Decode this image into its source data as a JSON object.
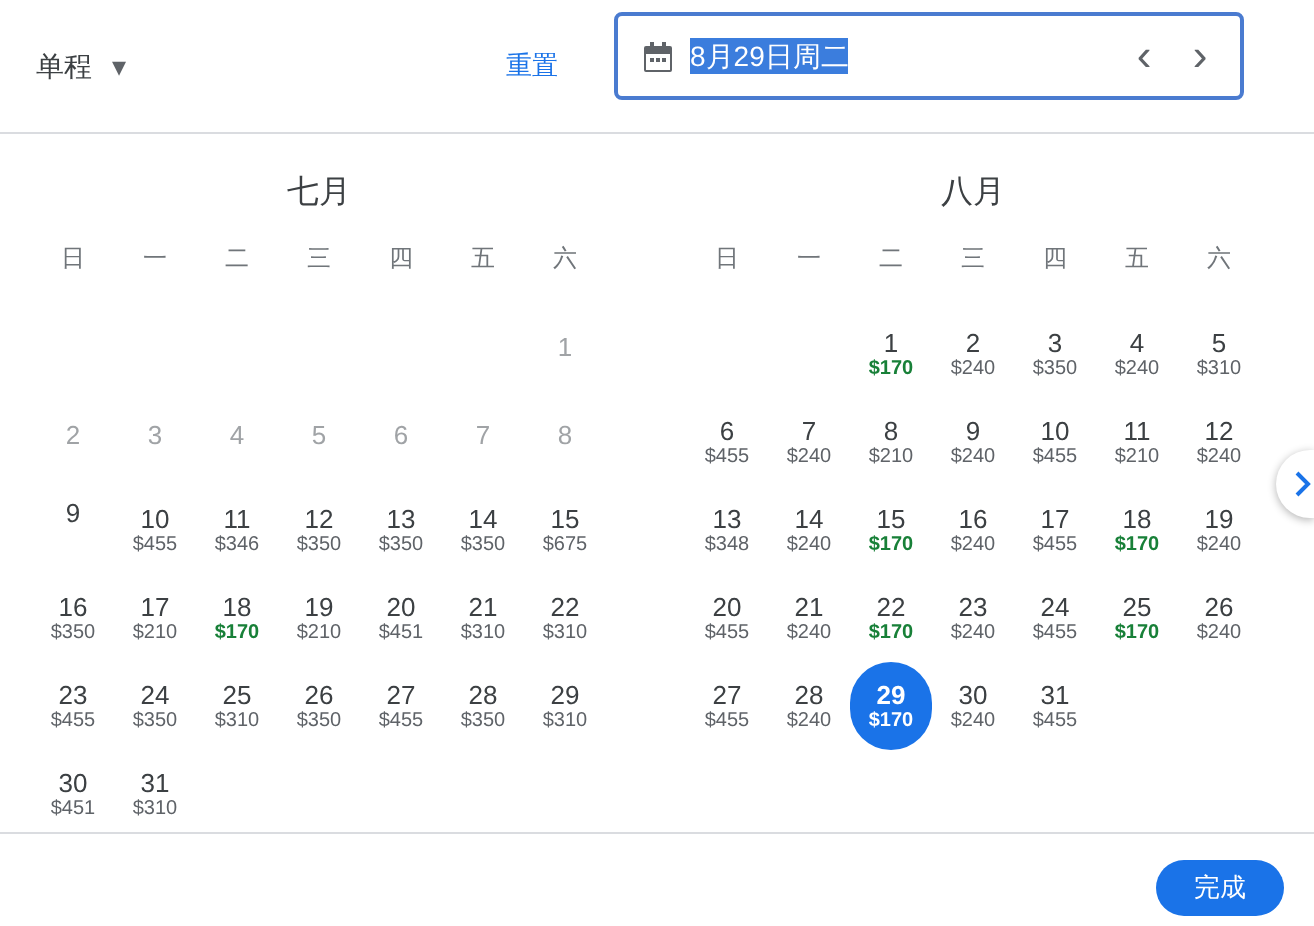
{
  "trip_type": {
    "label": "单程",
    "icon": "▾"
  },
  "reset_button": "重置",
  "date_field": {
    "value": "8月29日周二",
    "selected_text": true,
    "prev": "‹",
    "next": "›"
  },
  "months": [
    {
      "title": "七月",
      "weekdays": [
        "日",
        "一",
        "二",
        "三",
        "四",
        "五",
        "六"
      ],
      "weeks": [
        [
          {
            "kind": "blank"
          },
          {
            "kind": "blank"
          },
          {
            "kind": "blank"
          },
          {
            "kind": "blank"
          },
          {
            "kind": "blank"
          },
          {
            "kind": "blank"
          },
          {
            "kind": "past",
            "day": "1"
          }
        ],
        [
          {
            "kind": "past",
            "day": "2"
          },
          {
            "kind": "past",
            "day": "3"
          },
          {
            "kind": "past",
            "day": "4"
          },
          {
            "kind": "past",
            "day": "5"
          },
          {
            "kind": "past",
            "day": "6"
          },
          {
            "kind": "past",
            "day": "7"
          },
          {
            "kind": "past",
            "day": "8"
          }
        ],
        [
          {
            "kind": "day",
            "day": "9",
            "selected": false
          },
          {
            "kind": "day",
            "day": "10",
            "price": "$455",
            "selected": false,
            "cheap": false
          },
          {
            "kind": "day",
            "day": "11",
            "price": "$346",
            "selected": false,
            "cheap": false
          },
          {
            "kind": "day",
            "day": "12",
            "price": "$350",
            "selected": false,
            "cheap": false
          },
          {
            "kind": "day",
            "day": "13",
            "price": "$350",
            "selected": false,
            "cheap": false
          },
          {
            "kind": "day",
            "day": "14",
            "price": "$350",
            "selected": false,
            "cheap": false
          },
          {
            "kind": "day",
            "day": "15",
            "price": "$675",
            "selected": false,
            "cheap": false
          }
        ],
        [
          {
            "kind": "day",
            "day": "16",
            "price": "$350",
            "selected": false,
            "cheap": false
          },
          {
            "kind": "day",
            "day": "17",
            "price": "$210",
            "selected": false,
            "cheap": false
          },
          {
            "kind": "day",
            "day": "18",
            "price": "$170",
            "selected": false,
            "cheap": true
          },
          {
            "kind": "day",
            "day": "19",
            "price": "$210",
            "selected": false,
            "cheap": false
          },
          {
            "kind": "day",
            "day": "20",
            "price": "$451",
            "selected": false,
            "cheap": false
          },
          {
            "kind": "day",
            "day": "21",
            "price": "$310",
            "selected": false,
            "cheap": false
          },
          {
            "kind": "day",
            "day": "22",
            "price": "$310",
            "selected": false,
            "cheap": false
          }
        ],
        [
          {
            "kind": "day",
            "day": "23",
            "price": "$455",
            "selected": false,
            "cheap": false
          },
          {
            "kind": "day",
            "day": "24",
            "price": "$350",
            "selected": false,
            "cheap": false
          },
          {
            "kind": "day",
            "day": "25",
            "price": "$310",
            "selected": false,
            "cheap": false
          },
          {
            "kind": "day",
            "day": "26",
            "price": "$350",
            "selected": false,
            "cheap": false
          },
          {
            "kind": "day",
            "day": "27",
            "price": "$455",
            "selected": false,
            "cheap": false
          },
          {
            "kind": "day",
            "day": "28",
            "price": "$350",
            "selected": false,
            "cheap": false
          },
          {
            "kind": "day",
            "day": "29",
            "price": "$310",
            "selected": false,
            "cheap": false
          }
        ],
        [
          {
            "kind": "day",
            "day": "30",
            "price": "$451",
            "selected": false,
            "cheap": false
          },
          {
            "kind": "day",
            "day": "31",
            "price": "$310",
            "selected": false,
            "cheap": false
          }
        ]
      ]
    },
    {
      "title": "八月",
      "weekdays": [
        "日",
        "一",
        "二",
        "三",
        "四",
        "五",
        "六"
      ],
      "weeks": [
        [
          {
            "kind": "blank"
          },
          {
            "kind": "blank"
          },
          {
            "kind": "day",
            "day": "1",
            "price": "$170",
            "selected": false,
            "cheap": true
          },
          {
            "kind": "day",
            "day": "2",
            "price": "$240",
            "selected": false,
            "cheap": false
          },
          {
            "kind": "day",
            "day": "3",
            "price": "$350",
            "selected": false,
            "cheap": false
          },
          {
            "kind": "day",
            "day": "4",
            "price": "$240",
            "selected": false,
            "cheap": false
          },
          {
            "kind": "day",
            "day": "5",
            "price": "$310",
            "selected": false,
            "cheap": false
          }
        ],
        [
          {
            "kind": "day",
            "day": "6",
            "price": "$455",
            "selected": false,
            "cheap": false
          },
          {
            "kind": "day",
            "day": "7",
            "price": "$240",
            "selected": false,
            "cheap": false
          },
          {
            "kind": "day",
            "day": "8",
            "price": "$210",
            "selected": false,
            "cheap": false
          },
          {
            "kind": "day",
            "day": "9",
            "price": "$240",
            "selected": false,
            "cheap": false
          },
          {
            "kind": "day",
            "day": "10",
            "price": "$455",
            "selected": false,
            "cheap": false
          },
          {
            "kind": "day",
            "day": "11",
            "price": "$210",
            "selected": false,
            "cheap": false
          },
          {
            "kind": "day",
            "day": "12",
            "price": "$240",
            "selected": false,
            "cheap": false
          }
        ],
        [
          {
            "kind": "day",
            "day": "13",
            "price": "$348",
            "selected": false,
            "cheap": false
          },
          {
            "kind": "day",
            "day": "14",
            "price": "$240",
            "selected": false,
            "cheap": false
          },
          {
            "kind": "day",
            "day": "15",
            "price": "$170",
            "selected": false,
            "cheap": true
          },
          {
            "kind": "day",
            "day": "16",
            "price": "$240",
            "selected": false,
            "cheap": false
          },
          {
            "kind": "day",
            "day": "17",
            "price": "$455",
            "selected": false,
            "cheap": false
          },
          {
            "kind": "day",
            "day": "18",
            "price": "$170",
            "selected": false,
            "cheap": true
          },
          {
            "kind": "day",
            "day": "19",
            "price": "$240",
            "selected": false,
            "cheap": false
          }
        ],
        [
          {
            "kind": "day",
            "day": "20",
            "price": "$455",
            "selected": false,
            "cheap": false
          },
          {
            "kind": "day",
            "day": "21",
            "price": "$240",
            "selected": false,
            "cheap": false
          },
          {
            "kind": "day",
            "day": "22",
            "price": "$170",
            "selected": false,
            "cheap": true
          },
          {
            "kind": "day",
            "day": "23",
            "price": "$240",
            "selected": false,
            "cheap": false
          },
          {
            "kind": "day",
            "day": "24",
            "price": "$455",
            "selected": false,
            "cheap": false
          },
          {
            "kind": "day",
            "day": "25",
            "price": "$170",
            "selected": false,
            "cheap": true
          },
          {
            "kind": "day",
            "day": "26",
            "price": "$240",
            "selected": false,
            "cheap": false
          }
        ],
        [
          {
            "kind": "day",
            "day": "27",
            "price": "$455",
            "selected": false,
            "cheap": false
          },
          {
            "kind": "day",
            "day": "28",
            "price": "$240",
            "selected": false,
            "cheap": false
          },
          {
            "kind": "day",
            "day": "29",
            "price": "$170",
            "selected": true,
            "cheap": true
          },
          {
            "kind": "day",
            "day": "30",
            "price": "$240",
            "selected": false,
            "cheap": false
          },
          {
            "kind": "day",
            "day": "31",
            "price": "$455",
            "selected": false,
            "cheap": false
          }
        ]
      ]
    }
  ],
  "done_button": "完成"
}
